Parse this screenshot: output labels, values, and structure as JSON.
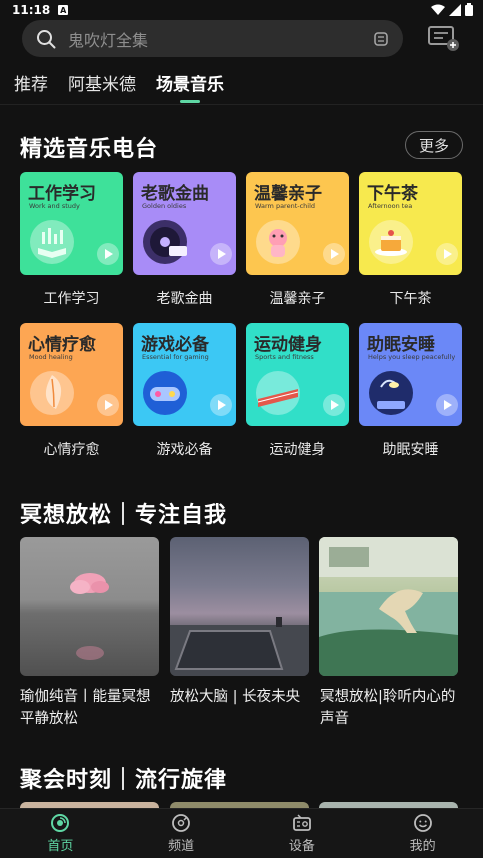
{
  "status_bar": {
    "time": "11:18",
    "a_badge": "A"
  },
  "search": {
    "placeholder": "鬼吹灯全集"
  },
  "tabs": [
    {
      "label": "推荐",
      "active": false
    },
    {
      "label": "阿基米德",
      "active": false
    },
    {
      "label": "场景音乐",
      "active": true
    }
  ],
  "radio_section": {
    "title": "精选音乐电台",
    "more_label": "更多",
    "cards": [
      {
        "title": "工作学习",
        "subtitle": "Work and study",
        "label": "工作学习",
        "color": "#3ee19a",
        "icon": "book-icon"
      },
      {
        "title": "老歌金曲",
        "subtitle": "Golden oldies",
        "label": "老歌金曲",
        "color": "#a88cf7",
        "icon": "vinyl-icon"
      },
      {
        "title": "温馨亲子",
        "subtitle": "Warm parent-child",
        "label": "温馨亲子",
        "color": "#fdc64f",
        "icon": "toy-icon"
      },
      {
        "title": "下午茶",
        "subtitle": "Afternoon tea",
        "label": "下午茶",
        "color": "#f7e94e",
        "icon": "cake-icon"
      },
      {
        "title": "心情疗愈",
        "subtitle": "Mood healing",
        "label": "心情疗愈",
        "color": "#fda653",
        "icon": "leaf-icon"
      },
      {
        "title": "游戏必备",
        "subtitle": "Essential for gaming",
        "label": "游戏必备",
        "color": "#3cc8f4",
        "icon": "gamepad-icon"
      },
      {
        "title": "运动健身",
        "subtitle": "Sports and fitness",
        "label": "运动健身",
        "color": "#31dfc8",
        "icon": "track-icon"
      },
      {
        "title": "助眠安睡",
        "subtitle": "Helps you sleep peacefully",
        "label": "助眠安睡",
        "color": "#6b88f7",
        "icon": "lamp-icon"
      }
    ]
  },
  "meditation_section": {
    "title": "冥想放松｜专注自我",
    "items": [
      {
        "caption": "瑜伽纯音丨能量冥想平静放松",
        "image": "pink-cloud-image"
      },
      {
        "caption": "放松大脑 | 长夜未央",
        "image": "pool-at-dusk-image"
      },
      {
        "caption": "冥想放松|聆听内心的声音",
        "image": "pond-landscape-image"
      }
    ]
  },
  "party_section": {
    "title": "聚会时刻｜流行旋律"
  },
  "bottom_nav": [
    {
      "label": "首页",
      "icon": "home-icon",
      "active": true
    },
    {
      "label": "频道",
      "icon": "channel-icon",
      "active": false
    },
    {
      "label": "设备",
      "icon": "device-icon",
      "active": false
    },
    {
      "label": "我的",
      "icon": "profile-icon",
      "active": false
    }
  ],
  "colors": {
    "accent": "#5fd7a4",
    "background": "#121212"
  }
}
